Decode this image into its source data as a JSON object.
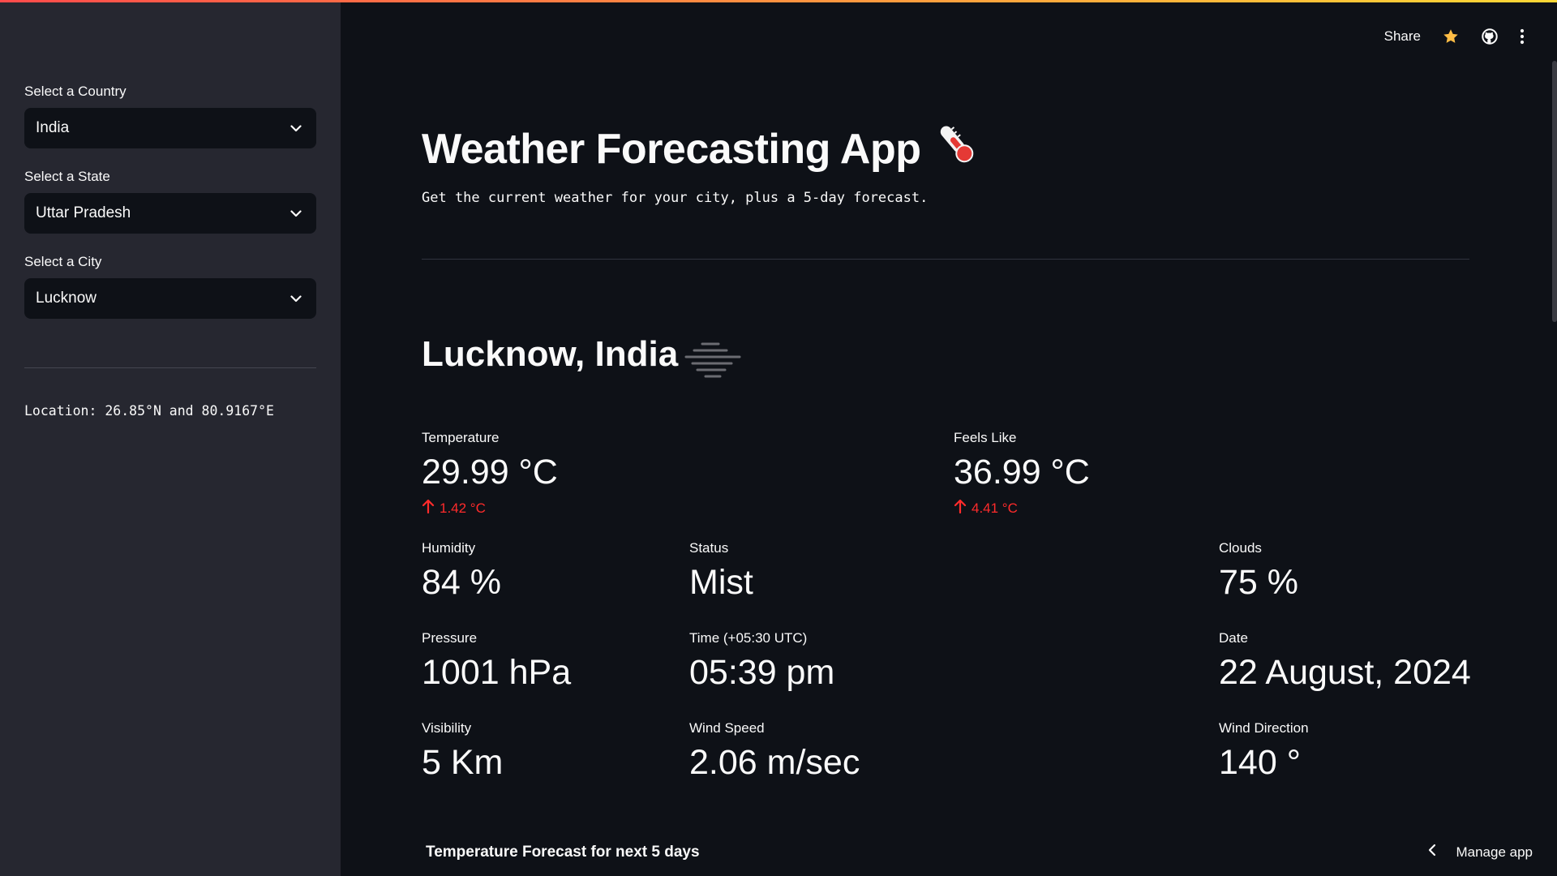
{
  "sidebar": {
    "country": {
      "label": "Select a Country",
      "value": "India"
    },
    "state": {
      "label": "Select a State",
      "value": "Uttar Pradesh"
    },
    "city": {
      "label": "Select a City",
      "value": "Lucknow"
    },
    "location_text": "Location: 26.85°N and 80.9167°E"
  },
  "header": {
    "share_label": "Share",
    "icons": [
      "star-icon",
      "github-icon",
      "more-vert-icon"
    ]
  },
  "main": {
    "title": "Weather Forecasting App",
    "title_emoji": "thermometer-icon",
    "subtitle": "Get the current weather for your city, plus a 5-day forecast.",
    "city_title": "Lucknow, India",
    "weather_icon": "mist-icon",
    "metrics": {
      "temperature": {
        "label": "Temperature",
        "value": "29.99 °C",
        "delta": "1.42 °C"
      },
      "feels_like": {
        "label": "Feels Like",
        "value": "36.99 °C",
        "delta": "4.41 °C"
      },
      "humidity": {
        "label": "Humidity",
        "value": "84 %"
      },
      "status": {
        "label": "Status",
        "value": "Mist"
      },
      "clouds": {
        "label": "Clouds",
        "value": "75 %"
      },
      "pressure": {
        "label": "Pressure",
        "value": "1001 hPa"
      },
      "time": {
        "label": "Time (+05:30 UTC)",
        "value": "05:39 pm"
      },
      "date": {
        "label": "Date",
        "value": "22 August, 2024"
      },
      "visibility": {
        "label": "Visibility",
        "value": "5 Km"
      },
      "wind_speed": {
        "label": "Wind Speed",
        "value": "2.06 m/sec"
      },
      "wind_direction": {
        "label": "Wind Direction",
        "value": "140 °"
      }
    },
    "forecast_heading": "Temperature Forecast for next 5 days"
  },
  "footer": {
    "manage_app_label": "Manage app"
  },
  "colors": {
    "background": "#0e1117",
    "sidebar": "#262730",
    "delta_red": "#ff2b2b",
    "accent_star": "#ffbd45"
  }
}
